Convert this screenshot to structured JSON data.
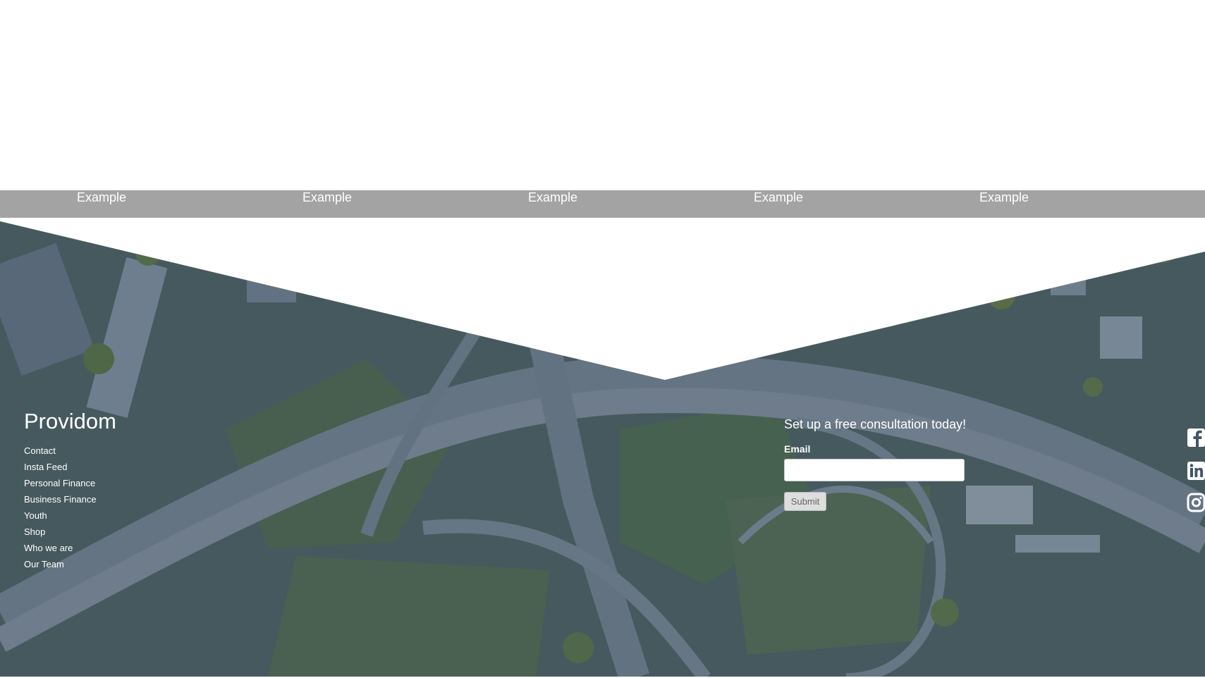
{
  "nav": {
    "items": [
      {
        "label": "Example"
      },
      {
        "label": "Example"
      },
      {
        "label": "Example"
      },
      {
        "label": "Example"
      },
      {
        "label": "Example"
      }
    ]
  },
  "brand": {
    "title": "Providom",
    "links": [
      "Contact",
      "Insta Feed",
      "Personal Finance",
      "Business Finance",
      "Youth",
      "Shop",
      "Who we are",
      "Our Team"
    ]
  },
  "consultation": {
    "heading": "Set up a free consultation today!",
    "email_label": "Email",
    "email_value": "",
    "submit_label": "Submit"
  },
  "social": {
    "icons": [
      "facebook-icon",
      "linkedin-icon",
      "instagram-icon"
    ]
  },
  "colors": {
    "nav_background": "#a3a3a3",
    "overlay_tint": "#3a506e"
  }
}
